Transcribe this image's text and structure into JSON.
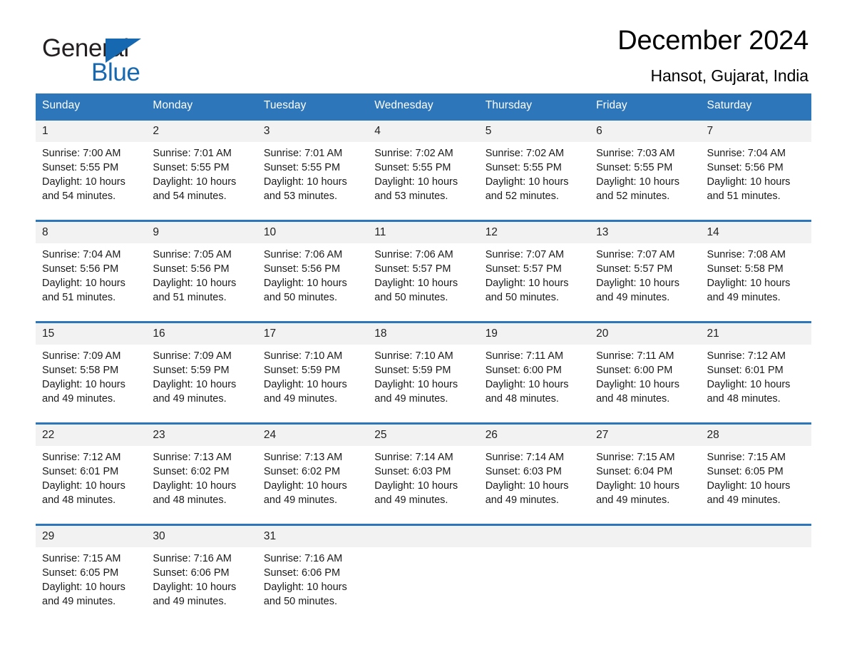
{
  "brand": {
    "name_part1": "General",
    "name_part2": "Blue",
    "triangle_color": "#1668b0"
  },
  "header": {
    "title": "December 2024",
    "subtitle": "Hansot, Gujarat, India"
  },
  "theme": {
    "header_blue": "#2d76b9",
    "daynum_band": "#f2f2f2",
    "text": "#1a1a1a"
  },
  "labels": {
    "sunrise_prefix": "Sunrise:",
    "sunset_prefix": "Sunset:",
    "daylight_prefix": "Daylight:"
  },
  "weekday_headers": [
    "Sunday",
    "Monday",
    "Tuesday",
    "Wednesday",
    "Thursday",
    "Friday",
    "Saturday"
  ],
  "weeks": [
    {
      "days": [
        {
          "date": "1",
          "sunrise": "Sunrise: 7:00 AM",
          "sunset": "Sunset: 5:55 PM",
          "daylight_line1": "Daylight: 10 hours",
          "daylight_line2": "and 54 minutes."
        },
        {
          "date": "2",
          "sunrise": "Sunrise: 7:01 AM",
          "sunset": "Sunset: 5:55 PM",
          "daylight_line1": "Daylight: 10 hours",
          "daylight_line2": "and 54 minutes."
        },
        {
          "date": "3",
          "sunrise": "Sunrise: 7:01 AM",
          "sunset": "Sunset: 5:55 PM",
          "daylight_line1": "Daylight: 10 hours",
          "daylight_line2": "and 53 minutes."
        },
        {
          "date": "4",
          "sunrise": "Sunrise: 7:02 AM",
          "sunset": "Sunset: 5:55 PM",
          "daylight_line1": "Daylight: 10 hours",
          "daylight_line2": "and 53 minutes."
        },
        {
          "date": "5",
          "sunrise": "Sunrise: 7:02 AM",
          "sunset": "Sunset: 5:55 PM",
          "daylight_line1": "Daylight: 10 hours",
          "daylight_line2": "and 52 minutes."
        },
        {
          "date": "6",
          "sunrise": "Sunrise: 7:03 AM",
          "sunset": "Sunset: 5:55 PM",
          "daylight_line1": "Daylight: 10 hours",
          "daylight_line2": "and 52 minutes."
        },
        {
          "date": "7",
          "sunrise": "Sunrise: 7:04 AM",
          "sunset": "Sunset: 5:56 PM",
          "daylight_line1": "Daylight: 10 hours",
          "daylight_line2": "and 51 minutes."
        }
      ]
    },
    {
      "days": [
        {
          "date": "8",
          "sunrise": "Sunrise: 7:04 AM",
          "sunset": "Sunset: 5:56 PM",
          "daylight_line1": "Daylight: 10 hours",
          "daylight_line2": "and 51 minutes."
        },
        {
          "date": "9",
          "sunrise": "Sunrise: 7:05 AM",
          "sunset": "Sunset: 5:56 PM",
          "daylight_line1": "Daylight: 10 hours",
          "daylight_line2": "and 51 minutes."
        },
        {
          "date": "10",
          "sunrise": "Sunrise: 7:06 AM",
          "sunset": "Sunset: 5:56 PM",
          "daylight_line1": "Daylight: 10 hours",
          "daylight_line2": "and 50 minutes."
        },
        {
          "date": "11",
          "sunrise": "Sunrise: 7:06 AM",
          "sunset": "Sunset: 5:57 PM",
          "daylight_line1": "Daylight: 10 hours",
          "daylight_line2": "and 50 minutes."
        },
        {
          "date": "12",
          "sunrise": "Sunrise: 7:07 AM",
          "sunset": "Sunset: 5:57 PM",
          "daylight_line1": "Daylight: 10 hours",
          "daylight_line2": "and 50 minutes."
        },
        {
          "date": "13",
          "sunrise": "Sunrise: 7:07 AM",
          "sunset": "Sunset: 5:57 PM",
          "daylight_line1": "Daylight: 10 hours",
          "daylight_line2": "and 49 minutes."
        },
        {
          "date": "14",
          "sunrise": "Sunrise: 7:08 AM",
          "sunset": "Sunset: 5:58 PM",
          "daylight_line1": "Daylight: 10 hours",
          "daylight_line2": "and 49 minutes."
        }
      ]
    },
    {
      "days": [
        {
          "date": "15",
          "sunrise": "Sunrise: 7:09 AM",
          "sunset": "Sunset: 5:58 PM",
          "daylight_line1": "Daylight: 10 hours",
          "daylight_line2": "and 49 minutes."
        },
        {
          "date": "16",
          "sunrise": "Sunrise: 7:09 AM",
          "sunset": "Sunset: 5:59 PM",
          "daylight_line1": "Daylight: 10 hours",
          "daylight_line2": "and 49 minutes."
        },
        {
          "date": "17",
          "sunrise": "Sunrise: 7:10 AM",
          "sunset": "Sunset: 5:59 PM",
          "daylight_line1": "Daylight: 10 hours",
          "daylight_line2": "and 49 minutes."
        },
        {
          "date": "18",
          "sunrise": "Sunrise: 7:10 AM",
          "sunset": "Sunset: 5:59 PM",
          "daylight_line1": "Daylight: 10 hours",
          "daylight_line2": "and 49 minutes."
        },
        {
          "date": "19",
          "sunrise": "Sunrise: 7:11 AM",
          "sunset": "Sunset: 6:00 PM",
          "daylight_line1": "Daylight: 10 hours",
          "daylight_line2": "and 48 minutes."
        },
        {
          "date": "20",
          "sunrise": "Sunrise: 7:11 AM",
          "sunset": "Sunset: 6:00 PM",
          "daylight_line1": "Daylight: 10 hours",
          "daylight_line2": "and 48 minutes."
        },
        {
          "date": "21",
          "sunrise": "Sunrise: 7:12 AM",
          "sunset": "Sunset: 6:01 PM",
          "daylight_line1": "Daylight: 10 hours",
          "daylight_line2": "and 48 minutes."
        }
      ]
    },
    {
      "days": [
        {
          "date": "22",
          "sunrise": "Sunrise: 7:12 AM",
          "sunset": "Sunset: 6:01 PM",
          "daylight_line1": "Daylight: 10 hours",
          "daylight_line2": "and 48 minutes."
        },
        {
          "date": "23",
          "sunrise": "Sunrise: 7:13 AM",
          "sunset": "Sunset: 6:02 PM",
          "daylight_line1": "Daylight: 10 hours",
          "daylight_line2": "and 48 minutes."
        },
        {
          "date": "24",
          "sunrise": "Sunrise: 7:13 AM",
          "sunset": "Sunset: 6:02 PM",
          "daylight_line1": "Daylight: 10 hours",
          "daylight_line2": "and 49 minutes."
        },
        {
          "date": "25",
          "sunrise": "Sunrise: 7:14 AM",
          "sunset": "Sunset: 6:03 PM",
          "daylight_line1": "Daylight: 10 hours",
          "daylight_line2": "and 49 minutes."
        },
        {
          "date": "26",
          "sunrise": "Sunrise: 7:14 AM",
          "sunset": "Sunset: 6:03 PM",
          "daylight_line1": "Daylight: 10 hours",
          "daylight_line2": "and 49 minutes."
        },
        {
          "date": "27",
          "sunrise": "Sunrise: 7:15 AM",
          "sunset": "Sunset: 6:04 PM",
          "daylight_line1": "Daylight: 10 hours",
          "daylight_line2": "and 49 minutes."
        },
        {
          "date": "28",
          "sunrise": "Sunrise: 7:15 AM",
          "sunset": "Sunset: 6:05 PM",
          "daylight_line1": "Daylight: 10 hours",
          "daylight_line2": "and 49 minutes."
        }
      ]
    },
    {
      "days": [
        {
          "date": "29",
          "sunrise": "Sunrise: 7:15 AM",
          "sunset": "Sunset: 6:05 PM",
          "daylight_line1": "Daylight: 10 hours",
          "daylight_line2": "and 49 minutes."
        },
        {
          "date": "30",
          "sunrise": "Sunrise: 7:16 AM",
          "sunset": "Sunset: 6:06 PM",
          "daylight_line1": "Daylight: 10 hours",
          "daylight_line2": "and 49 minutes."
        },
        {
          "date": "31",
          "sunrise": "Sunrise: 7:16 AM",
          "sunset": "Sunset: 6:06 PM",
          "daylight_line1": "Daylight: 10 hours",
          "daylight_line2": "and 50 minutes."
        },
        {
          "date": "",
          "sunrise": "",
          "sunset": "",
          "daylight_line1": "",
          "daylight_line2": ""
        },
        {
          "date": "",
          "sunrise": "",
          "sunset": "",
          "daylight_line1": "",
          "daylight_line2": ""
        },
        {
          "date": "",
          "sunrise": "",
          "sunset": "",
          "daylight_line1": "",
          "daylight_line2": ""
        },
        {
          "date": "",
          "sunrise": "",
          "sunset": "",
          "daylight_line1": "",
          "daylight_line2": ""
        }
      ]
    }
  ]
}
